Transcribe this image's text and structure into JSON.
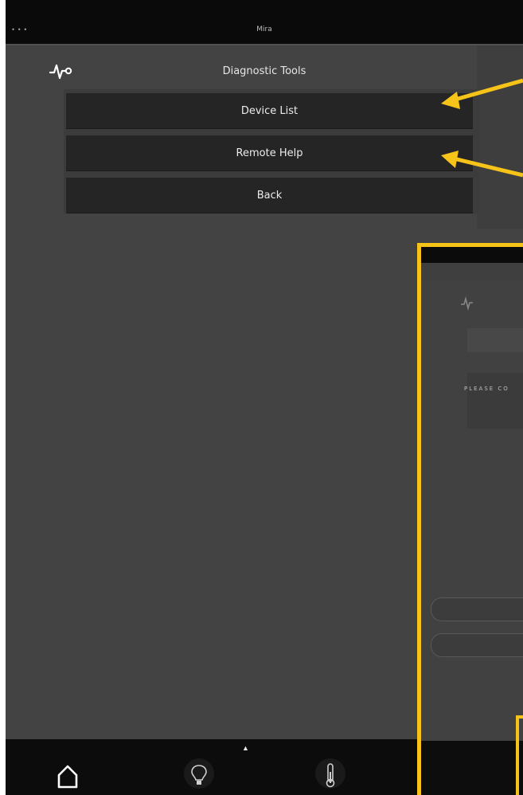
{
  "status_bar": {
    "dots": "• • •",
    "title": "Mira"
  },
  "header": {
    "title": "Diagnostic Tools",
    "icon": "pulse-icon"
  },
  "menu": {
    "items": [
      {
        "label": "Device List"
      },
      {
        "label": "Remote Help"
      },
      {
        "label": "Back"
      }
    ]
  },
  "bottom_nav": {
    "caret": "▲",
    "items": [
      {
        "icon": "home-icon"
      },
      {
        "icon": "lightbulb-icon"
      },
      {
        "icon": "thermometer-icon"
      }
    ]
  },
  "annotations": {
    "arrow_color": "#f6c419",
    "inset_preview_text": "PLEASE CO"
  },
  "colors": {
    "background": "#434343",
    "button": "#252525",
    "highlight": "#f6c419"
  }
}
